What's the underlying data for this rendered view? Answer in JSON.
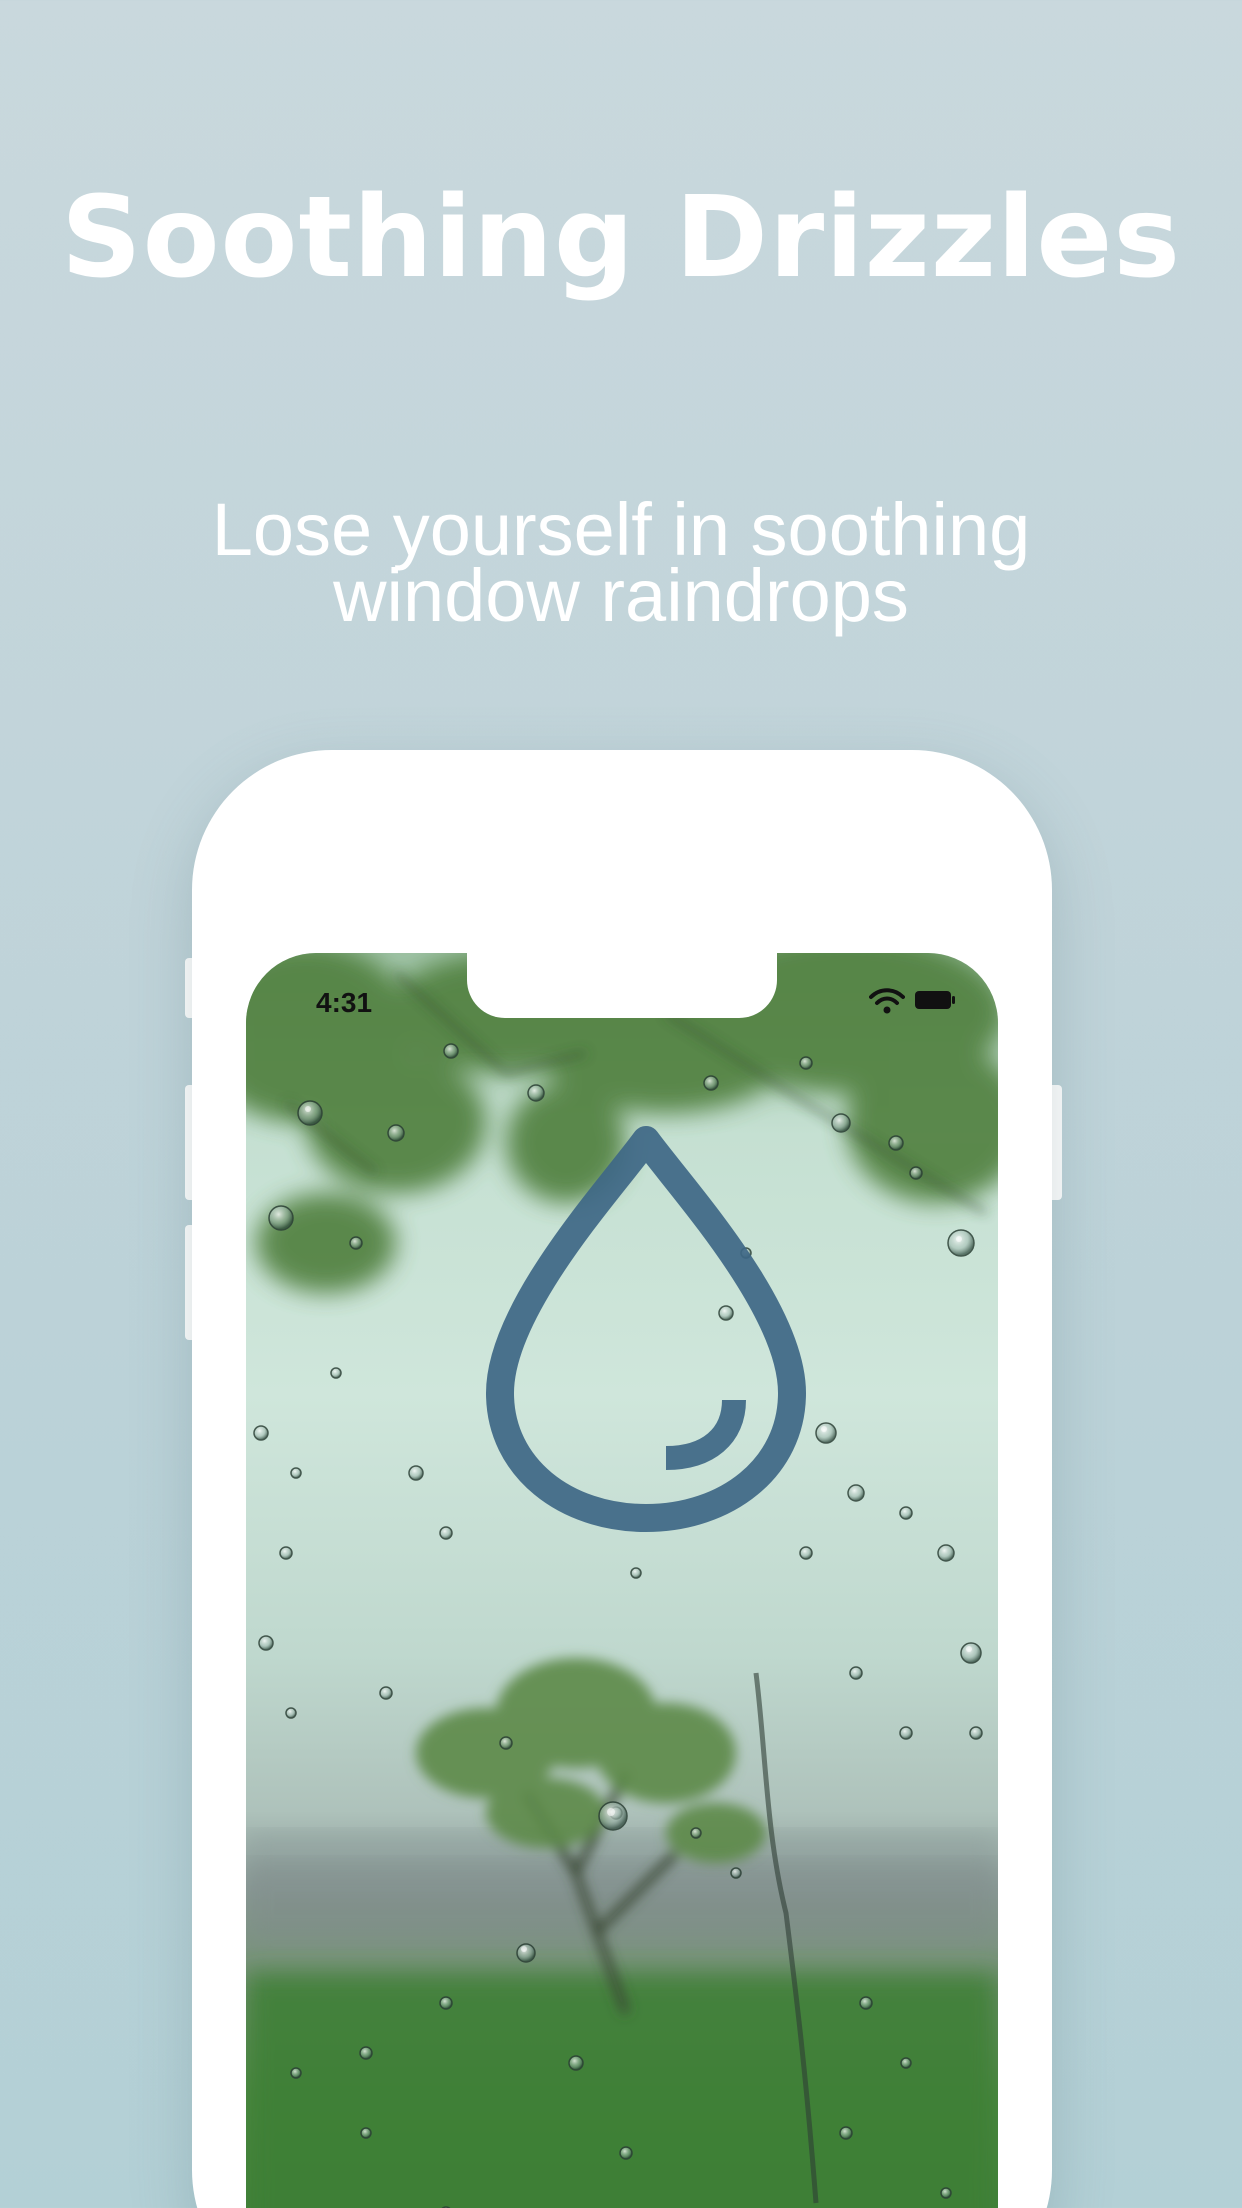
{
  "header": {
    "title": "Soothing Drizzles",
    "subtitle_line1": "Lose yourself in soothing",
    "subtitle_line2": "window raindrops"
  },
  "phone": {
    "status_bar": {
      "time": "4:31",
      "icons": [
        "wifi-icon",
        "battery-icon"
      ]
    },
    "app_icon": "raindrop-icon"
  },
  "colors": {
    "background": "#c3d6db",
    "title_text": "#ffffff",
    "drop_icon": "#3e6785",
    "frame": "#ffffff"
  }
}
